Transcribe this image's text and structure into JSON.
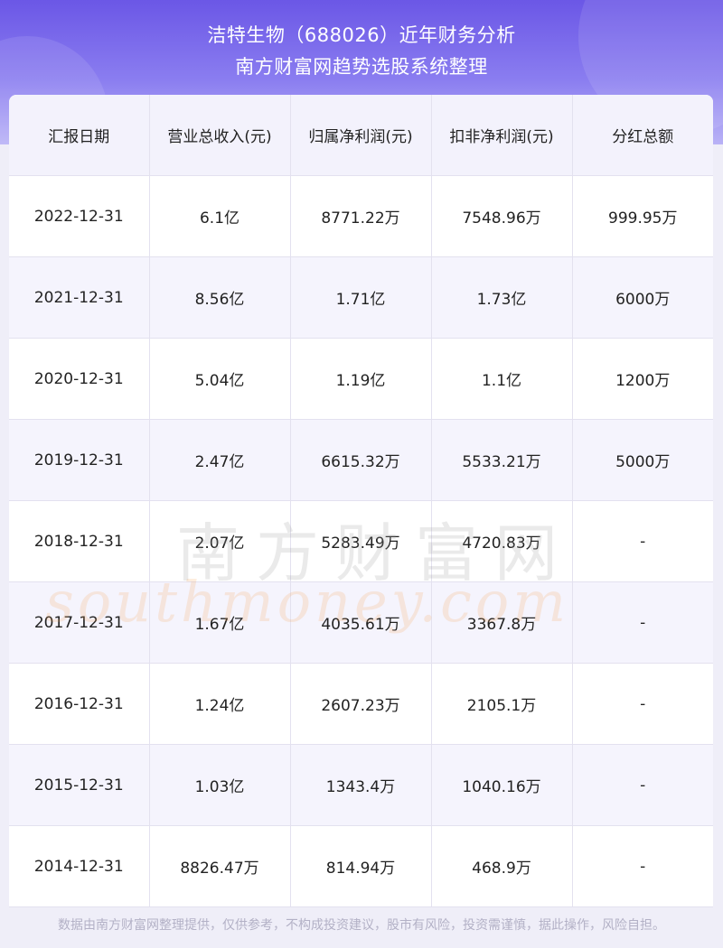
{
  "header": {
    "title": "洁特生物（688026）近年财务分析",
    "subtitle": "南方财富网趋势选股系统整理"
  },
  "table": {
    "columns": [
      "汇报日期",
      "营业总收入(元)",
      "归属净利润(元)",
      "扣非净利润(元)",
      "分红总额"
    ],
    "rows": [
      [
        "2022-12-31",
        "6.1亿",
        "8771.22万",
        "7548.96万",
        "999.95万"
      ],
      [
        "2021-12-31",
        "8.56亿",
        "1.71亿",
        "1.73亿",
        "6000万"
      ],
      [
        "2020-12-31",
        "5.04亿",
        "1.19亿",
        "1.1亿",
        "1200万"
      ],
      [
        "2019-12-31",
        "2.47亿",
        "6615.32万",
        "5533.21万",
        "5000万"
      ],
      [
        "2018-12-31",
        "2.07亿",
        "5283.49万",
        "4720.83万",
        "-"
      ],
      [
        "2017-12-31",
        "1.67亿",
        "4035.61万",
        "3367.8万",
        "-"
      ],
      [
        "2016-12-31",
        "1.24亿",
        "2607.23万",
        "2105.1万",
        "-"
      ],
      [
        "2015-12-31",
        "1.03亿",
        "1343.4万",
        "1040.16万",
        "-"
      ],
      [
        "2014-12-31",
        "8826.47万",
        "814.94万",
        "468.9万",
        "-"
      ]
    ]
  },
  "watermark": {
    "cn": "南方财富网",
    "en": "southmoney.com"
  },
  "footer": {
    "disclaimer": "数据由南方财富网整理提供，仅供参考，不构成投资建议，股市有风险，投资需谨慎，据此操作，风险自担。"
  },
  "colors": {
    "header_top": "#6b57e6",
    "header_bottom": "#b9b2f6",
    "row_alt": "#f5f4fd",
    "border": "#e3e1ef"
  }
}
